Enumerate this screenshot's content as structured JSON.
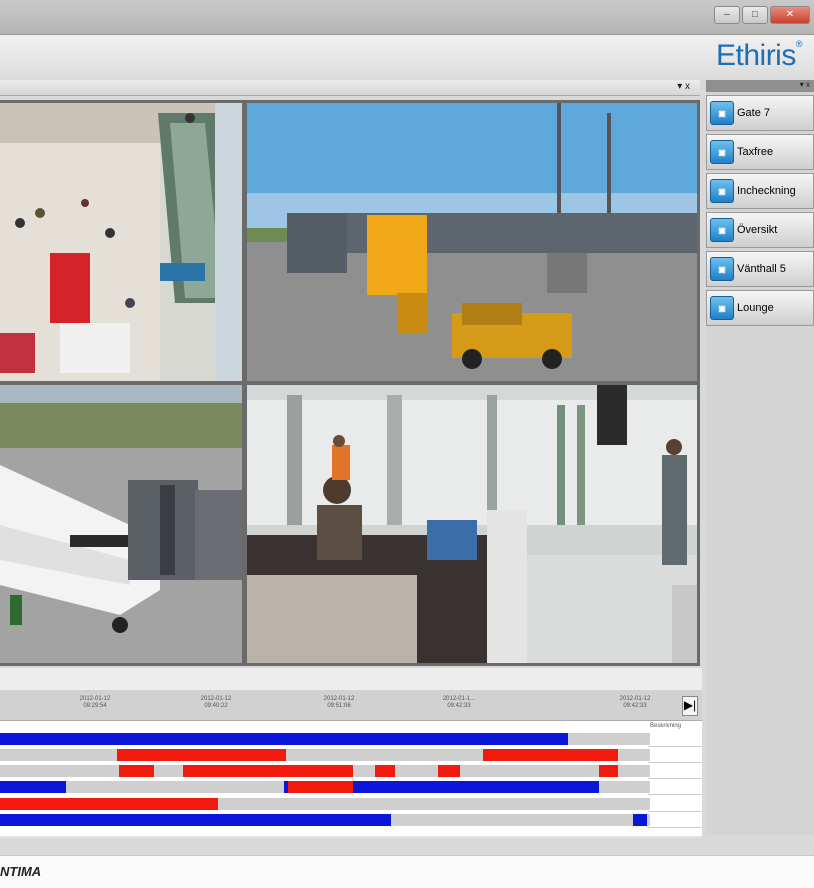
{
  "logo": {
    "text": "Ethiris",
    "mark": "®",
    "color": "#1d6fb5"
  },
  "window_controls": [
    "minimize-icon",
    "maximize-icon",
    "close-icon"
  ],
  "main_header_buttons": "▾ x",
  "right_panel": {
    "header_buttons": "▾ x",
    "presets": [
      {
        "label": "Gate 7",
        "icon": "camera-preset-icon"
      },
      {
        "label": "Taxfree",
        "icon": "camera-preset-icon"
      },
      {
        "label": "Incheckning",
        "icon": "camera-preset-icon"
      },
      {
        "label": "Översikt",
        "icon": "camera-preset-icon"
      },
      {
        "label": "Vänthall 5",
        "icon": "camera-preset-icon"
      },
      {
        "label": "Lounge",
        "icon": "camera-preset-icon"
      }
    ]
  },
  "timeline": {
    "ticks": [
      {
        "date": "2012-01-12",
        "time": "09:29:54"
      },
      {
        "date": "2012-01-12",
        "time": "09:40:22"
      },
      {
        "date": "2012-01-12",
        "time": "09:51:06"
      },
      {
        "date": "2012-01-1...",
        "time": "09:42:33"
      },
      {
        "date": "2012-01-12",
        "time": "09:42:33"
      }
    ],
    "side_label": "Beskrivning",
    "next_button": "▶|",
    "colors": {
      "blue": "#0c16d8",
      "red": "#f21a0e",
      "gray": "#cfcfcf"
    },
    "rows": [
      [
        [
          "blue",
          0,
          568
        ]
      ],
      [
        [
          "red",
          117,
          286
        ],
        [
          "red",
          483,
          618
        ]
      ],
      [
        [
          "red",
          119,
          154
        ],
        [
          "red",
          183,
          353
        ],
        [
          "red",
          375,
          395
        ],
        [
          "red",
          438,
          460
        ],
        [
          "red",
          599,
          618
        ]
      ],
      [
        [
          "blue",
          0,
          66
        ],
        [
          "blue",
          284,
          599
        ],
        [
          "red",
          288,
          353
        ]
      ],
      [
        [
          "red",
          0,
          218
        ]
      ],
      [
        [
          "blue",
          0,
          391
        ],
        [
          "blue",
          633,
          647
        ]
      ]
    ]
  },
  "status": {
    "brand": "NTIMA"
  }
}
